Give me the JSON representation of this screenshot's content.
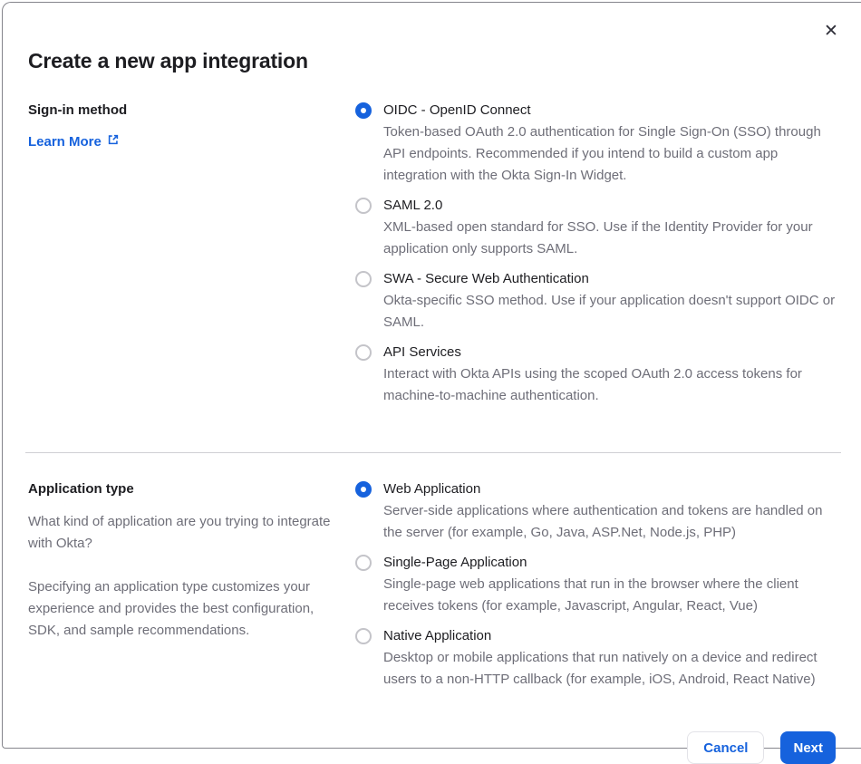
{
  "dialog": {
    "title": "Create a new app integration",
    "close_icon": "✕"
  },
  "signin_section": {
    "label": "Sign-in method",
    "learn_more_label": "Learn More",
    "options": [
      {
        "label": "OIDC - OpenID Connect",
        "description": "Token-based OAuth 2.0 authentication for Single Sign-On (SSO) through API endpoints. Recommended if you intend to build a custom app integration with the Okta Sign-In Widget.",
        "selected": true
      },
      {
        "label": "SAML 2.0",
        "description": "XML-based open standard for SSO. Use if the Identity Provider for your application only supports SAML.",
        "selected": false
      },
      {
        "label": "SWA - Secure Web Authentication",
        "description": "Okta-specific SSO method. Use if your application doesn't support OIDC or SAML.",
        "selected": false
      },
      {
        "label": "API Services",
        "description": "Interact with Okta APIs using the scoped OAuth 2.0 access tokens for machine-to-machine authentication.",
        "selected": false
      }
    ]
  },
  "apptype_section": {
    "label": "Application type",
    "paragraphs": {
      "p1": "What kind of application are you trying to integrate with Okta?",
      "p2": "Specifying an application type customizes your experience and provides the best configuration, SDK, and sample recommendations."
    },
    "options": [
      {
        "label": "Web Application",
        "description": "Server-side applications where authentication and tokens are handled on the server (for example, Go, Java, ASP.Net, Node.js, PHP)",
        "selected": true
      },
      {
        "label": "Single-Page Application",
        "description": "Single-page web applications that run in the browser where the client receives tokens (for example, Javascript, Angular, React, Vue)",
        "selected": false
      },
      {
        "label": "Native Application",
        "description": "Desktop or mobile applications that run natively on a device and redirect users to a non-HTTP callback (for example, iOS, Android, React Native)",
        "selected": false
      }
    ]
  },
  "footer": {
    "cancel_label": "Cancel",
    "next_label": "Next"
  },
  "colors": {
    "accent_blue": "#1662dd",
    "heading_text": "#1d1d21",
    "body_text": "#6e6e78",
    "divider": "#cfcfd4",
    "radio_unselected_border": "#c4c4c9"
  }
}
